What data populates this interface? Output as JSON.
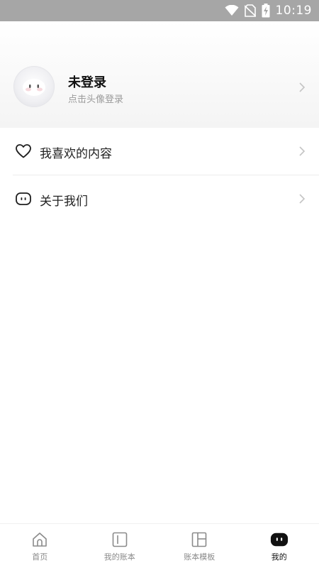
{
  "status_bar": {
    "time": "10:19",
    "icons": [
      "wifi-icon",
      "no-sim-icon",
      "battery-charging-icon"
    ]
  },
  "profile": {
    "name": "未登录",
    "hint": "点击头像登录",
    "avatar_icon": "avatar-placeholder-icon"
  },
  "menu": {
    "items": [
      {
        "label": "我喜欢的内容",
        "icon": "heart-icon"
      },
      {
        "label": "关于我们",
        "icon": "robot-face-icon"
      }
    ]
  },
  "bottom_nav": {
    "active_index": 3,
    "items": [
      {
        "label": "首页",
        "icon": "home-icon"
      },
      {
        "label": "我的账本",
        "icon": "ledger-icon"
      },
      {
        "label": "账本模板",
        "icon": "template-icon"
      },
      {
        "label": "我的",
        "icon": "robot-face-icon"
      }
    ]
  },
  "colors": {
    "status_bar_bg": "#a6a6a6",
    "text_primary": "#111111",
    "text_secondary": "#9b9b9b",
    "nav_inactive": "#8a8a8a",
    "nav_active": "#111111"
  }
}
